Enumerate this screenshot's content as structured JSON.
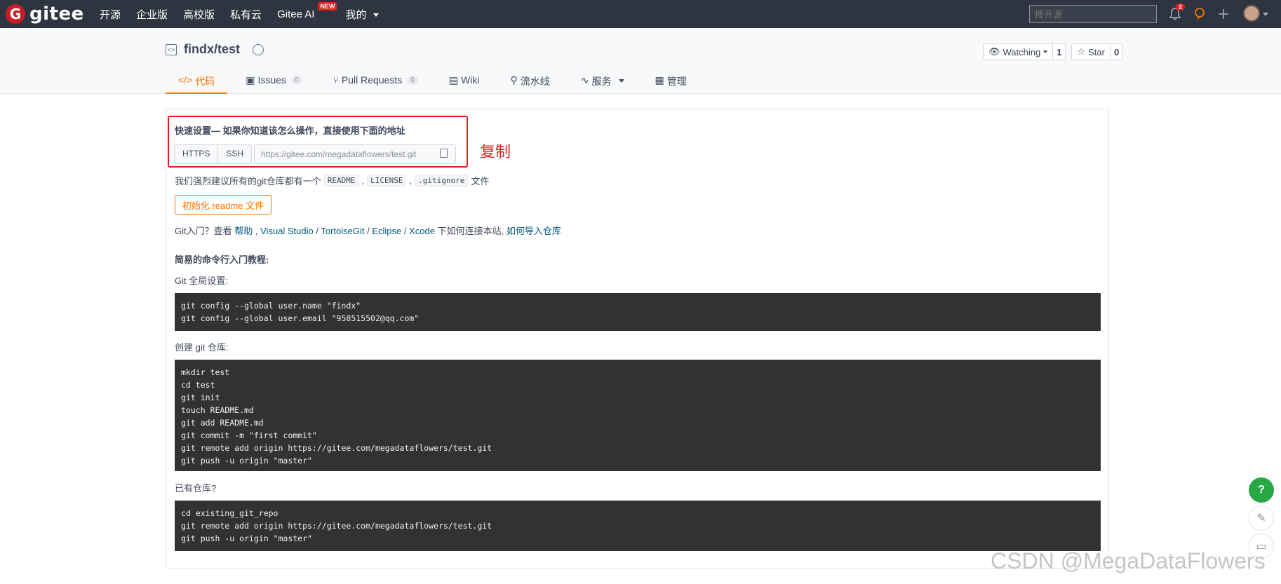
{
  "topbar": {
    "logo_mark": "G",
    "logo_text": "gitee",
    "nav": [
      {
        "label": "开源"
      },
      {
        "label": "企业版"
      },
      {
        "label": "高校版"
      },
      {
        "label": "私有云"
      },
      {
        "label": "Gitee AI",
        "badge": "NEW"
      },
      {
        "label": "我的"
      }
    ],
    "search_placeholder": "搜开源",
    "notifications_count": "2"
  },
  "repo": {
    "title": "findx/test",
    "watch_label": "Watching",
    "watch_count": "1",
    "star_label": "Star",
    "star_count": "0"
  },
  "tabs": [
    {
      "label": "代码",
      "icon": "code-icon"
    },
    {
      "label": "Issues",
      "count": "0",
      "icon": "issues-icon"
    },
    {
      "label": "Pull Requests",
      "count": "0",
      "icon": "pull-request-icon"
    },
    {
      "label": "Wiki",
      "icon": "wiki-icon"
    },
    {
      "label": "流水线",
      "icon": "pipeline-icon"
    },
    {
      "label": "服务",
      "icon": "service-icon"
    },
    {
      "label": "管理",
      "icon": "manage-icon"
    }
  ],
  "quick_setup": {
    "title": "快速设置— 如果你知道该怎么操作，直接使用下面的地址",
    "https_label": "HTTPS",
    "ssh_label": "SSH",
    "url": "https://gitee.com/megadataflowers/test.git",
    "annotation": "复制"
  },
  "recommend": {
    "prefix": "我们强烈建议所有的git仓库都有一个",
    "files": [
      "README",
      "LICENSE",
      ".gitignore"
    ],
    "sep": ",",
    "suffix": "文件"
  },
  "init_button": "初始化 readme 文件",
  "git_intro": {
    "prefix": "Git入门？查看 ",
    "help": "帮助",
    "vs": "Visual Studio",
    "tortoise": "TortoiseGit",
    "eclipse": "Eclipse",
    "xcode": "Xcode",
    "mid": " 下如何连接本站, ",
    "import": "如何导入仓库"
  },
  "tutorial": {
    "title": "简易的命令行入门教程:",
    "global_label": "Git 全局设置:",
    "global_code": [
      "git config --global user.name \"findx\"",
      "git config --global user.email \"958515502@qq.com\""
    ],
    "create_label": "创建 git 仓库:",
    "create_code": [
      "mkdir test",
      "cd test",
      "git init",
      "touch README.md",
      "git add README.md",
      "git commit -m \"first commit\"",
      "git remote add origin https://gitee.com/megadataflowers/test.git",
      "git push -u origin \"master\""
    ],
    "existing_label": "已有仓库?",
    "existing_code": [
      "cd existing_git_repo",
      "git remote add origin https://gitee.com/megadataflowers/test.git",
      "git push -u origin \"master\""
    ]
  },
  "floating": {
    "help": "?"
  },
  "watermark": "CSDN @MegaDataFlowers"
}
